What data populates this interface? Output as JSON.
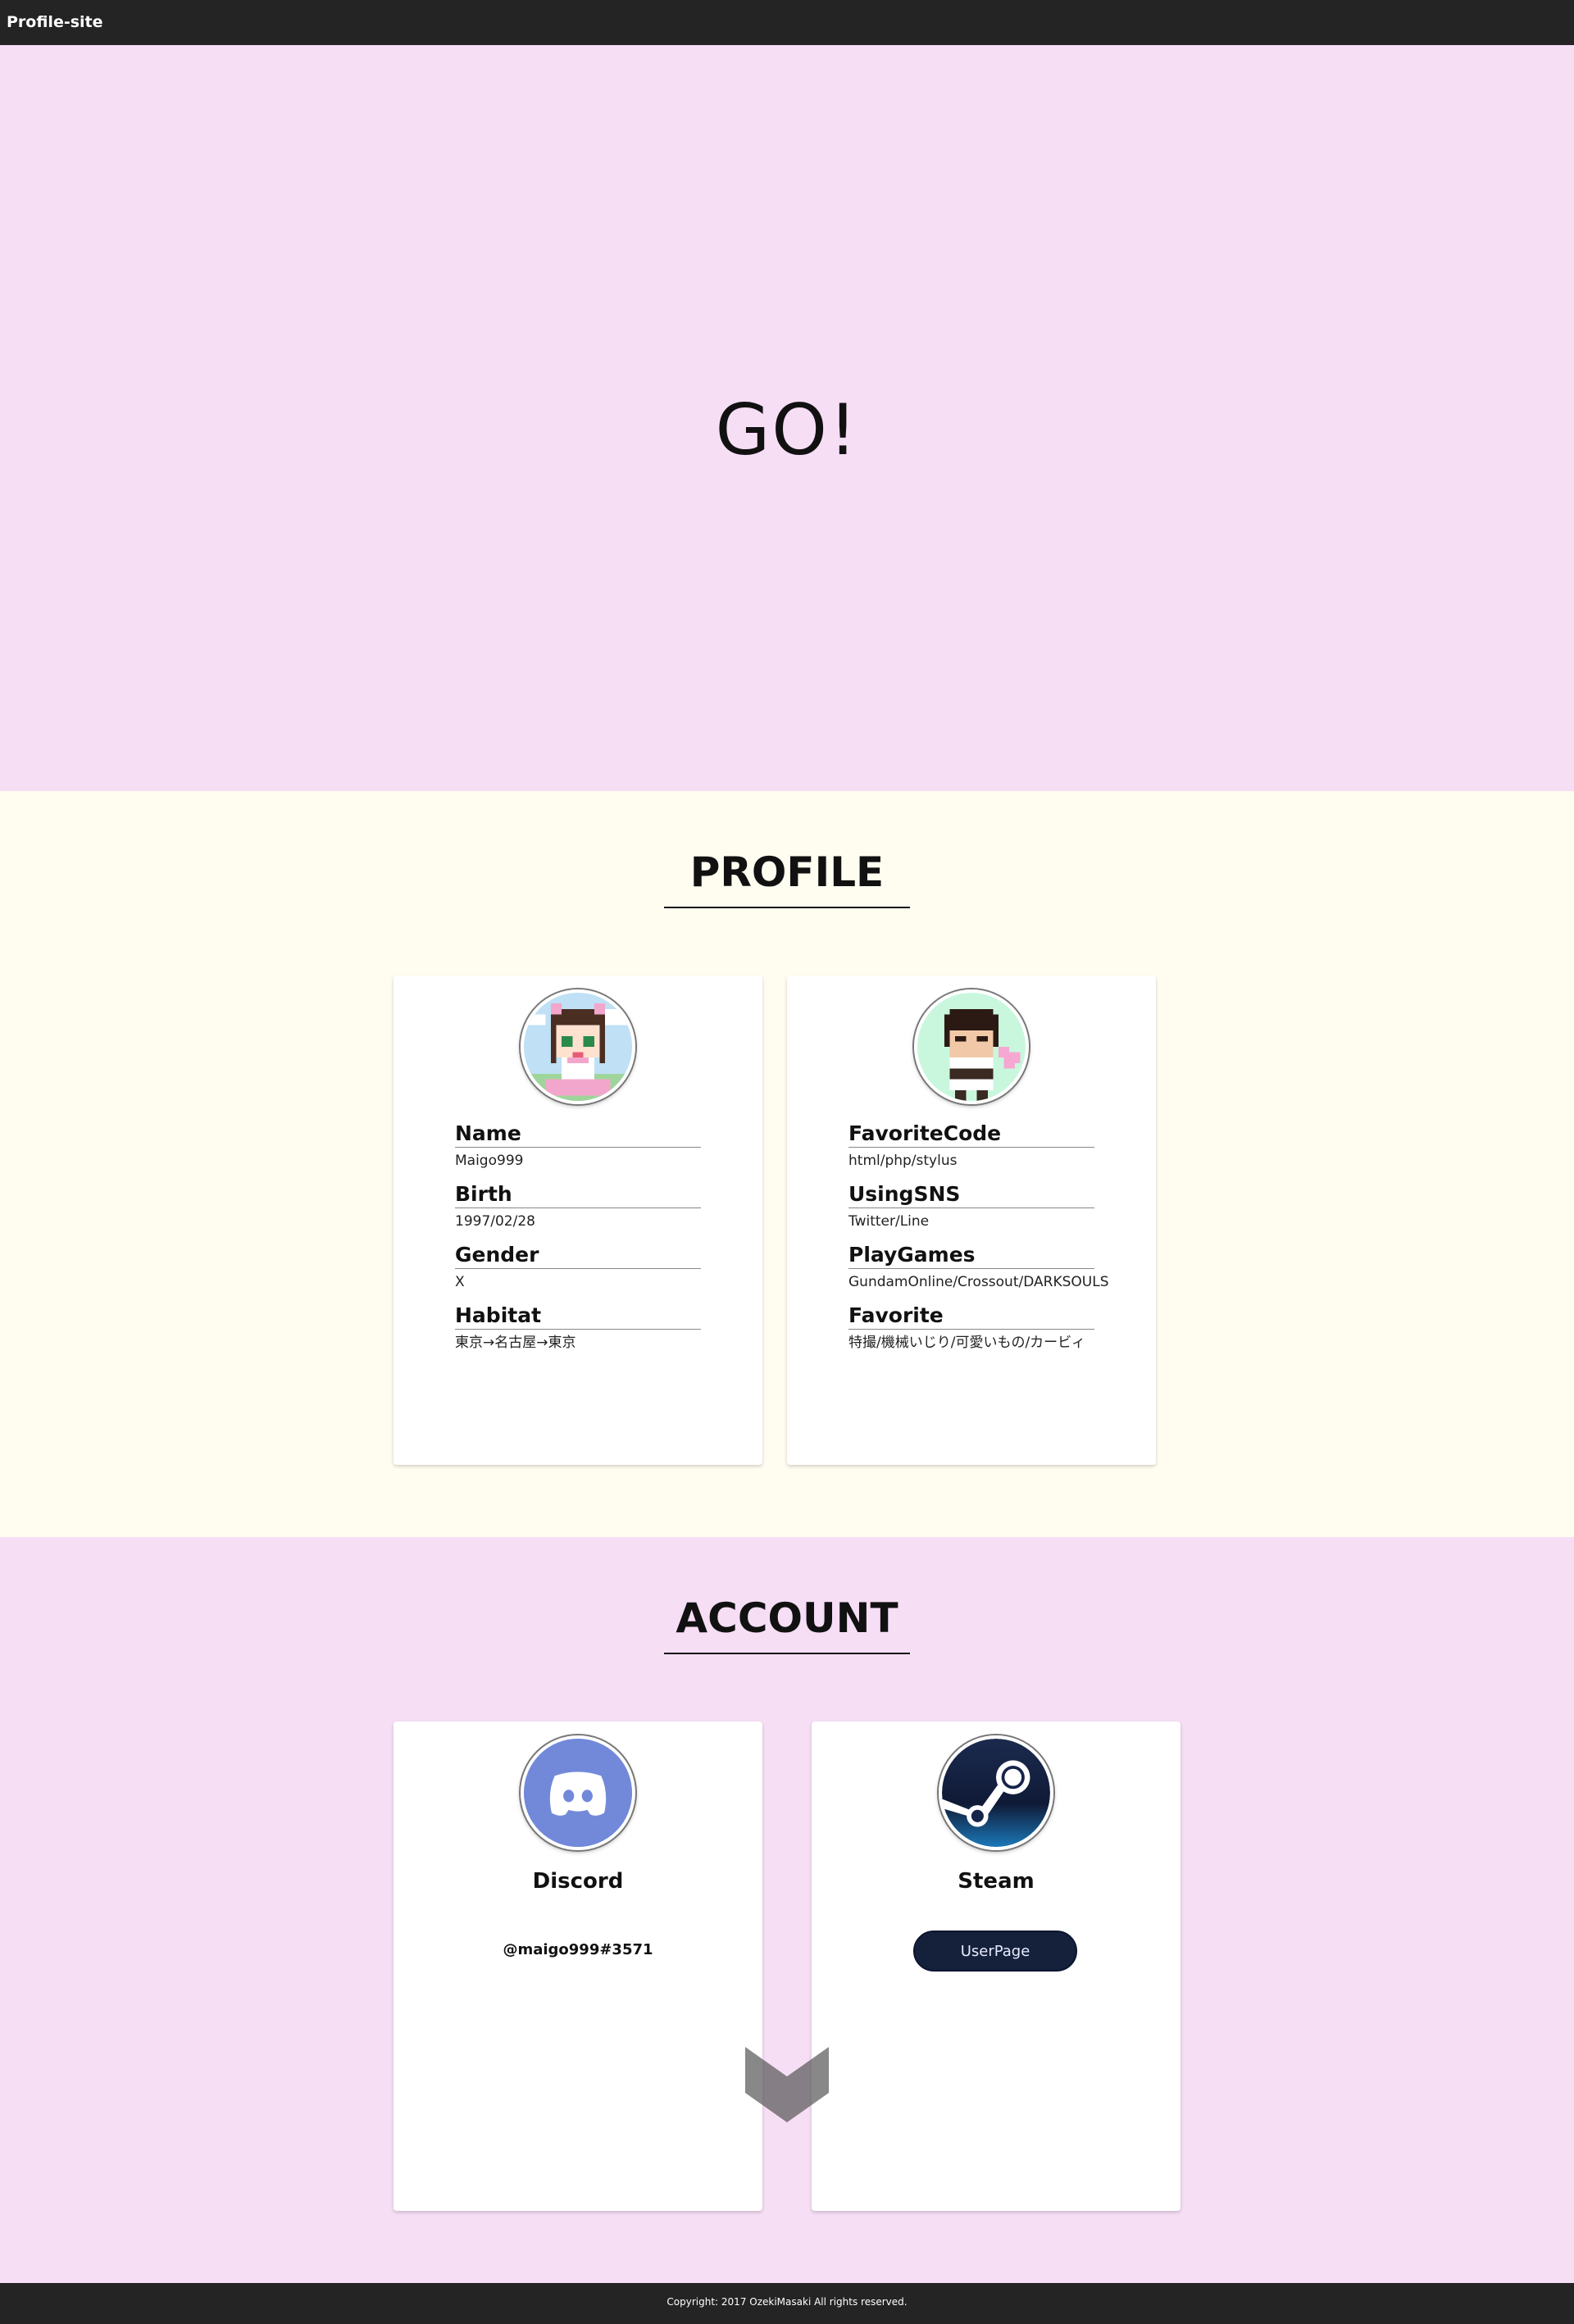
{
  "header": {
    "brand": "Profile-site"
  },
  "hero": {
    "text": "GO!"
  },
  "profile": {
    "title": "PROFILE",
    "left_card": {
      "avatar_icon": "pixel-avatar-cat-ear-girl",
      "fields": [
        {
          "label": "Name",
          "value": "Maigo999"
        },
        {
          "label": "Birth",
          "value": "1997/02/28"
        },
        {
          "label": "Gender",
          "value": "X"
        },
        {
          "label": "Habitat",
          "value": "東京→名古屋→東京"
        }
      ]
    },
    "right_card": {
      "avatar_icon": "pixel-avatar-character",
      "fields": [
        {
          "label": "FavoriteCode",
          "value": "html/php/stylus"
        },
        {
          "label": "UsingSNS",
          "value": "Twitter/Line"
        },
        {
          "label": "PlayGames",
          "value": "GundamOnline/Crossout/DARKSOULS"
        },
        {
          "label": "Favorite",
          "value": "特撮/機械いじり/可愛いもの/カービィ"
        }
      ]
    }
  },
  "account": {
    "title": "ACCOUNT",
    "discord": {
      "icon": "discord-icon",
      "name": "Discord",
      "handle": "@maigo999#3571"
    },
    "steam": {
      "icon": "steam-icon",
      "name": "Steam",
      "button": "UserPage"
    }
  },
  "footer": {
    "copyright": "Copyright: 2017 OzekiMasaki All rights reserved."
  },
  "colors": {
    "topbar": "#242424",
    "pink_bg": "#f6def5",
    "cream_bg": "#fffdf0",
    "steam_button": "#15203a",
    "discord_blurple": "#7289da"
  }
}
